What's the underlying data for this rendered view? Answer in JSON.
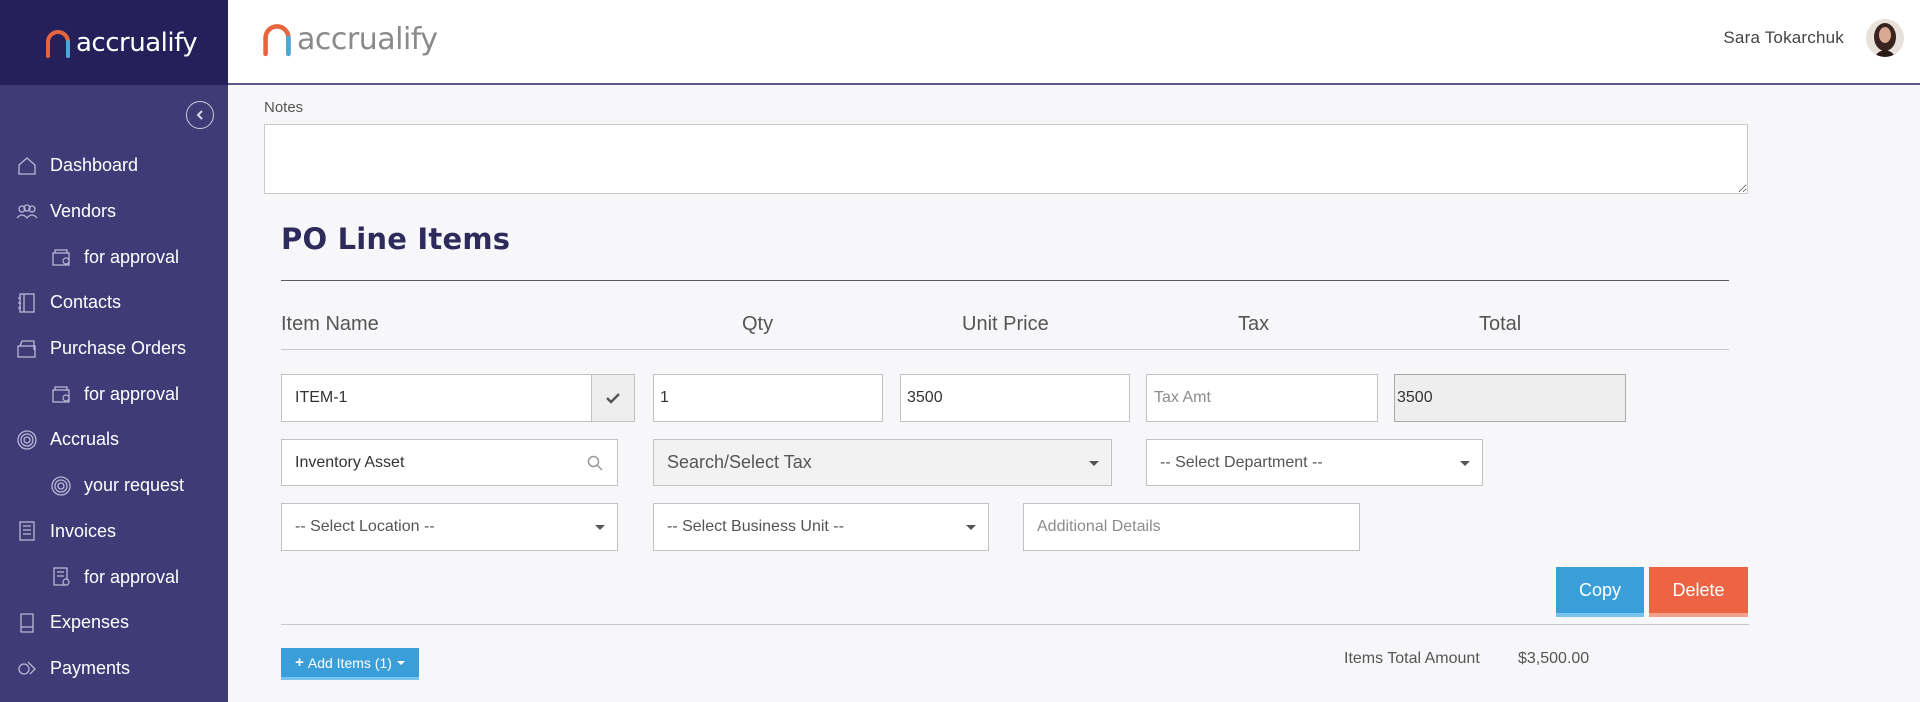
{
  "brand": {
    "name": "accrualify"
  },
  "sidebar": {
    "items": [
      {
        "label": "Dashboard",
        "icon": "home-icon"
      },
      {
        "label": "Vendors",
        "icon": "users-icon"
      },
      {
        "label": "for approval",
        "icon": "cards-icon"
      },
      {
        "label": "Contacts",
        "icon": "contact-book-icon"
      },
      {
        "label": "Purchase Orders",
        "icon": "cards-icon"
      },
      {
        "label": "for approval",
        "icon": "cards-icon"
      },
      {
        "label": "Accruals",
        "icon": "target-icon"
      },
      {
        "label": "your request",
        "icon": "target-icon"
      },
      {
        "label": "Invoices",
        "icon": "document-icon"
      },
      {
        "label": "for approval",
        "icon": "document-icon"
      },
      {
        "label": "Expenses",
        "icon": "receipt-icon"
      },
      {
        "label": "Payments",
        "icon": "money-icon"
      }
    ]
  },
  "header": {
    "user_name": "Sara Tokarchuk"
  },
  "form": {
    "notes_label": "Notes",
    "notes_value": "",
    "section_title": "PO Line Items",
    "columns": [
      "Item Name",
      "Qty",
      "Unit Price",
      "Tax",
      "Total"
    ],
    "line": {
      "item_name": "ITEM-1",
      "qty": "1",
      "unit_price": "3500",
      "tax_placeholder": "Tax Amt",
      "total": "3500",
      "account": "Inventory Asset",
      "tax_select": "Search/Select Tax",
      "department_select": "-- Select Department --",
      "location_select": "-- Select Location --",
      "business_unit_select": "-- Select Business Unit --",
      "details_placeholder": "Additional Details"
    },
    "copy_label": "Copy",
    "delete_label": "Delete",
    "add_items_label": "Add Items (1)",
    "items_total_label": "Items Total Amount",
    "items_total_value": "$3,500.00"
  },
  "colors": {
    "sidebar": "#3f3b77",
    "sidebar_brand": "#25205a",
    "primary": "#3a9fd8",
    "danger": "#ec6444",
    "title": "#2e2a5c"
  }
}
